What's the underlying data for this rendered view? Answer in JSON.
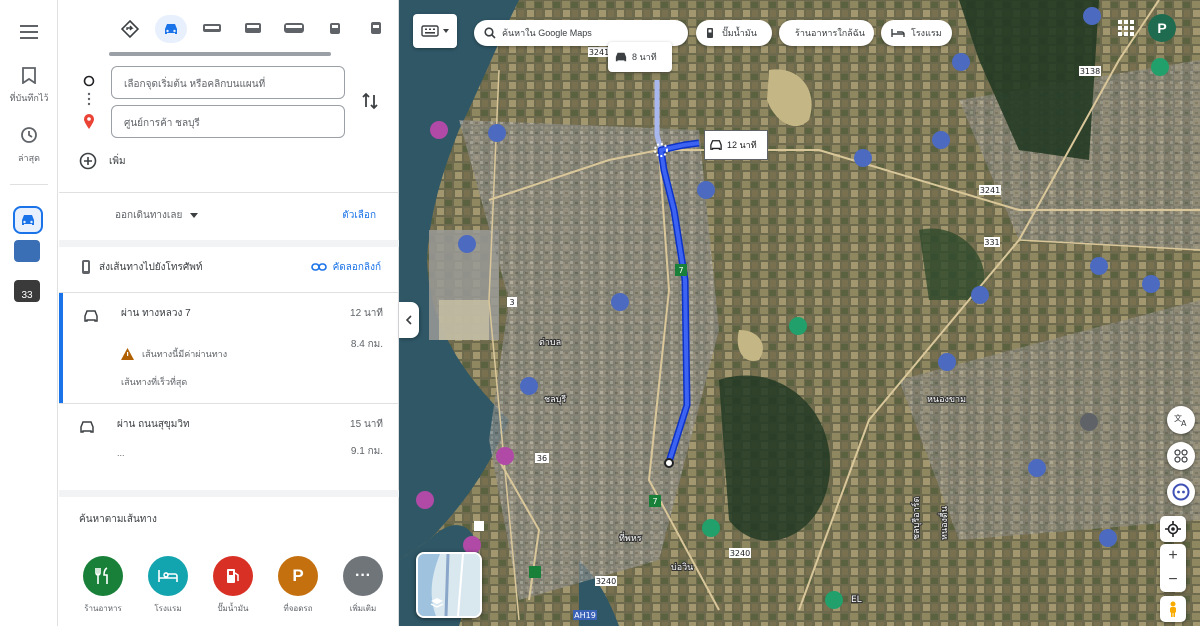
{
  "rail": {
    "saved_label": "ที่บันทึกไว้",
    "recent_label": "ล่าสุด",
    "recent_thumb_badge": "33"
  },
  "panel": {
    "origin_placeholder": "เลือกจุดเริ่มต้น หรือคลิกบนแผนที่",
    "destination_value": "ศูนย์การค้า ชลบุรี",
    "add_stop_label": "เพิ่ม",
    "depart_label": "ออกเดินทางเลย",
    "options_label": "ตัวเลือก",
    "send_label": "ส่งเส้นทางไปยังโทรศัพท์",
    "copy_link_label": "คัดลอกลิงก์"
  },
  "routes": [
    {
      "title": "ผ่าน ทางหลวง 7",
      "time": "12 นาที",
      "distance": "8.4 กม.",
      "warning": "เส้นทางนี้มีค่าผ่านทาง",
      "meta": "เส้นทางที่เร็วที่สุด"
    },
    {
      "title": "ผ่าน ถนนสุขุมวิท",
      "time": "15 นาที",
      "distance": "9.1 กม.",
      "meta": "..."
    }
  ],
  "nearby": {
    "heading": "ค้นหาตามเส้นทาง",
    "categories": [
      {
        "label": "ร้านอาหาร",
        "icon": "restaurant-icon",
        "color": "#188038"
      },
      {
        "label": "โรงแรม",
        "icon": "hotel-icon",
        "color": "#12a4af"
      },
      {
        "label": "ปั๊มน้ำมัน",
        "icon": "gas-station-icon",
        "color": "#d93025"
      },
      {
        "label": "ที่จอดรถ",
        "icon": "parking-icon",
        "color": "#c5700e"
      },
      {
        "label": "เพิ่มเติม",
        "icon": "more-icon",
        "color": "#70757a"
      }
    ]
  },
  "map": {
    "search_text": "ค้นหาใน Google Maps",
    "chips": [
      {
        "label": "ปั๊มน้ำมัน",
        "icon": "gas-station-icon"
      },
      {
        "label": "ร้านอาหารใกล้ฉัน",
        "icon": "restaurant-icon"
      },
      {
        "label": "โรงแรม",
        "icon": "hotel-icon"
      }
    ],
    "route_tip": "8 นาที",
    "route_label": "12 นาที",
    "avatar_letter": "P",
    "road_labels": [
      "3241",
      "3138",
      "3241",
      "331",
      "3240",
      "3240",
      "AH19",
      "36",
      "3",
      "7",
      "7"
    ],
    "place_labels": [
      "ต่าบล",
      "ชลบุรี",
      "ที่พหร",
      "EL",
      "บ่อวิน",
      "หนองขาม",
      "ชลบุรีอาร์ต",
      "หนองตื่น"
    ]
  },
  "accent": "#1a73e8",
  "route_color": "#1a3ed6"
}
